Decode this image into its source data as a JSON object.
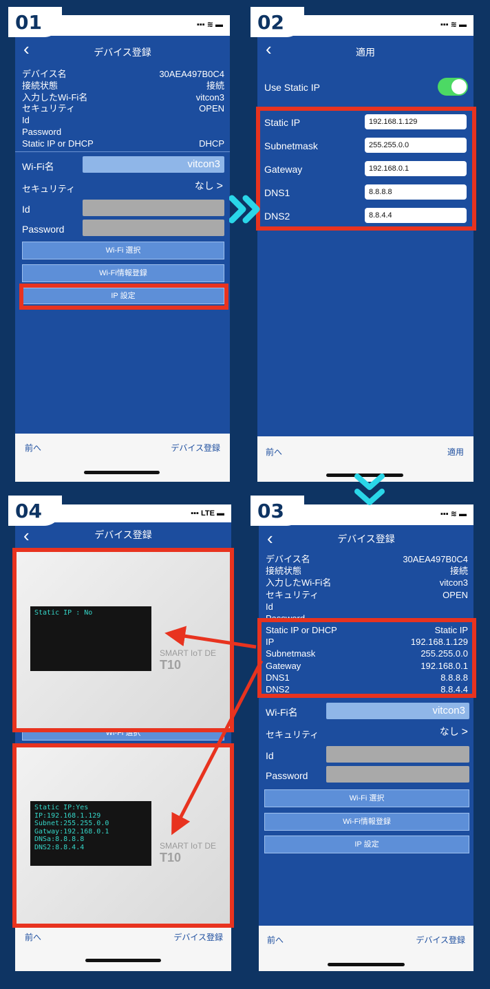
{
  "badges": [
    "01",
    "02",
    "03",
    "04"
  ],
  "status": {
    "signal": "▪▪▪ ≋ ▬",
    "signal_lte": "▪▪▪ LTE ▬"
  },
  "phone1": {
    "title": "デバイス登録",
    "info": [
      {
        "label": "デバイス名",
        "value": "30AEA497B0C4"
      },
      {
        "label": "接続状態",
        "value": "接続"
      },
      {
        "label": "入力したWi-Fi名",
        "value": "vitcon3"
      },
      {
        "label": "セキュリティ",
        "value": "OPEN"
      },
      {
        "label": "Id",
        "value": ""
      },
      {
        "label": "Password",
        "value": ""
      },
      {
        "label": "Static IP or DHCP",
        "value": "DHCP"
      }
    ],
    "wifi_label": "Wi-Fi名",
    "wifi_value": "vitcon3",
    "security_label": "セキュリティ",
    "security_value": "なし",
    "id_label": "Id",
    "password_label": "Password",
    "btn_wifi_select": "Wi-Fi 選択",
    "btn_wifi_register": "Wi-Fi情報登録",
    "btn_ip": "IP 設定",
    "footer_prev": "前へ",
    "footer_next": "デバイス登録"
  },
  "phone2": {
    "title": "適用",
    "use_static_label": "Use Static IP",
    "use_static_on": true,
    "fields": [
      {
        "label": "Static IP",
        "value": "192.168.1.129"
      },
      {
        "label": "Subnetmask",
        "value": "255.255.0.0"
      },
      {
        "label": "Gateway",
        "value": "192.168.0.1"
      },
      {
        "label": "DNS1",
        "value": "8.8.8.8"
      },
      {
        "label": "DNS2",
        "value": "8.8.4.4"
      }
    ],
    "footer_prev": "前へ",
    "footer_next": "適用"
  },
  "phone3": {
    "title": "デバイス登録",
    "info": [
      {
        "label": "デバイス名",
        "value": "30AEA497B0C4"
      },
      {
        "label": "接続状態",
        "value": "接続"
      },
      {
        "label": "入力したWi-Fi名",
        "value": "vitcon3"
      },
      {
        "label": "セキュリティ",
        "value": "OPEN"
      },
      {
        "label": "Id",
        "value": ""
      },
      {
        "label": "Password",
        "value": ""
      }
    ],
    "ipinfo": [
      {
        "label": "Static IP or DHCP",
        "value": "Static IP"
      },
      {
        "label": "IP",
        "value": "192.168.1.129"
      },
      {
        "label": "Subnetmask",
        "value": "255.255.0.0"
      },
      {
        "label": "Gateway",
        "value": "192.168.0.1"
      },
      {
        "label": "DNS1",
        "value": "8.8.8.8"
      },
      {
        "label": "DNS2",
        "value": "8.8.4.4"
      }
    ],
    "wifi_label": "Wi-Fi名",
    "wifi_value": "vitcon3",
    "security_label": "セキュリティ",
    "security_value": "なし",
    "id_label": "Id",
    "password_label": "Password",
    "btn_wifi_select": "Wi-Fi 選択",
    "btn_wifi_register": "Wi-Fi情報登録",
    "btn_ip": "IP 設定",
    "footer_prev": "前へ",
    "footer_next": "デバイス登録"
  },
  "phone4": {
    "title": "デバイス登録",
    "lcd_top": "Static IP : No",
    "lcd_bottom": "Static IP:Yes\nIP:192.168.1.129\nSubnet:255.255.0.0\nGatway:192.168.0.1\nDNSa:8.8.8.8\nDNS2:8.8.4.4",
    "brand_line": "SMART IoT DE",
    "brand_model": "T10",
    "peek_button": "Wi-Fi 選択",
    "footer_prev": "前へ",
    "footer_next": "デバイス登録"
  },
  "colors": {
    "accent_red": "#e8331f",
    "nav_blue": "#1c4d9e",
    "bg_navy": "#0e3463",
    "arrow_cyan": "#2ad6e8"
  }
}
